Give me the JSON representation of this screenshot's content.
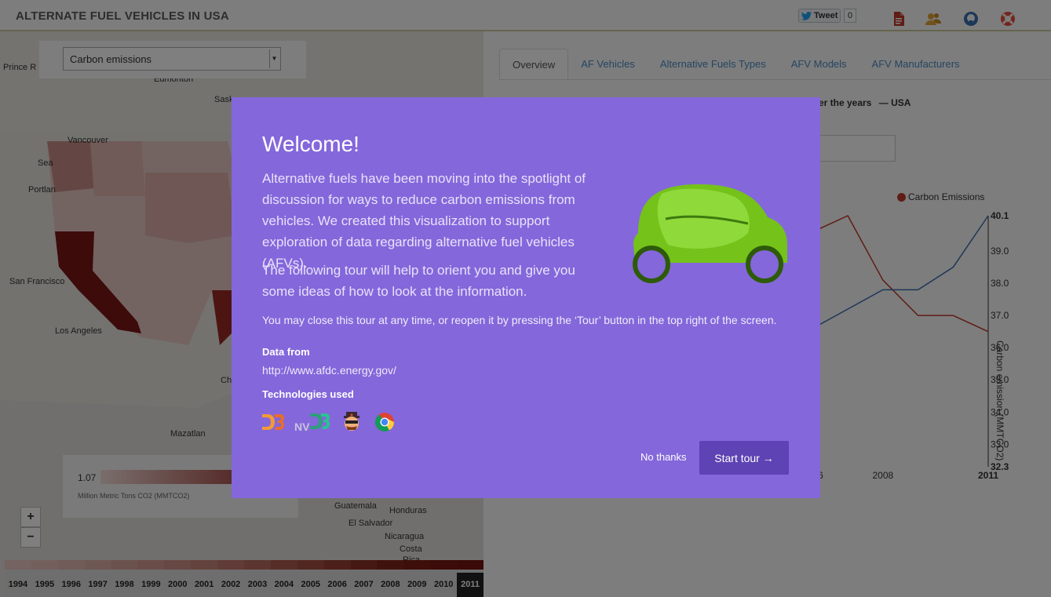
{
  "header": {
    "title": "ALTERNATE FUEL VEHICLES IN USA",
    "tweet_label": "Tweet",
    "tweet_count": "0",
    "icons": [
      "document-icon",
      "people-icon",
      "github-icon",
      "lifebuoy-icon"
    ]
  },
  "map": {
    "metric_select": "Carbon emissions",
    "cities": [
      "Prince R",
      "Edmonton",
      "Sask",
      "Vancouver",
      "Sea",
      "Portlan",
      "San Francisco",
      "Los Angeles",
      "Ch",
      "Mazatlan",
      "Guatemala",
      "El Salvador",
      "Honduras",
      "Nicaragua",
      "Costa",
      "Rica"
    ],
    "legend_min": "1.07",
    "legend_unit": "Million Metric Tons CO2 (MMTCO2)",
    "zoom_in": "+",
    "zoom_out": "−",
    "years": [
      "1994",
      "1995",
      "1996",
      "1997",
      "1998",
      "1999",
      "2000",
      "2001",
      "2002",
      "2003",
      "2004",
      "2005",
      "2006",
      "2007",
      "2008",
      "2009",
      "2010",
      "2011"
    ],
    "selected_year": "2011"
  },
  "tabs": [
    "Overview",
    "AF Vehicles",
    "Alternative Fuels Types",
    "AFV Models",
    "AFV Manufacturers"
  ],
  "chart": {
    "heading_partial": "er the years",
    "heading_region": "— USA"
  },
  "chart_data": {
    "type": "line",
    "series": [
      {
        "name": "Carbon Emissions",
        "color": "#c0392b",
        "x": [
          2004,
          2006,
          2007,
          2008,
          2009,
          2010,
          2011
        ],
        "y": [
          36.8,
          39.6,
          40.1,
          38.1,
          37.0,
          37.0,
          36.5
        ]
      },
      {
        "color": "#3a6fb0",
        "x": [
          2004,
          2006,
          2007,
          2008,
          2009,
          2010,
          2011
        ],
        "y": [
          36.1,
          36.6,
          37.2,
          37.8,
          37.8,
          38.5,
          40.1
        ]
      }
    ],
    "x_ticks": [
      "2006",
      "2008",
      "2011"
    ],
    "y_ticks": [
      "40.1",
      "39.0",
      "38.0",
      "37.0",
      "36.0",
      "35.0",
      "34.0",
      "33.0",
      "32.3"
    ],
    "ylabel": "Carbon emission (MMTCO2)",
    "ylim": [
      32.3,
      40.1
    ]
  },
  "modal": {
    "title": "Welcome!",
    "intro": "Alternative fuels have been moving into the spotlight of discussion for ways to reduce carbon emissions from vehicles. We created this visualization to support exploration of data regarding alternative fuel vehicles (AFVs).",
    "tour_text": "The following tour will help to orient you and give you some ideas of how to look at the information.",
    "close_note": "You may close this tour at any time, or reopen it by pressing the ‘Tour’ button in the top right of the screen.",
    "data_from_label": "Data from",
    "data_from_url": "http://www.afdc.energy.gov/",
    "tech_label": "Technologies used",
    "no_thanks": "No thanks",
    "start_tour": "Start tour →"
  }
}
